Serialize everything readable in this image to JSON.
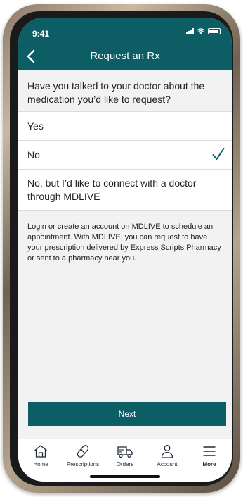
{
  "status_bar": {
    "time": "9:41"
  },
  "header": {
    "title": "Request an Rx"
  },
  "question": "Have you talked to your doctor about the medication you’d like to request?",
  "options": [
    {
      "label": "Yes",
      "selected": false
    },
    {
      "label": "No",
      "selected": true
    },
    {
      "label": "No, but I’d like to connect with a doctor through MDLIVE",
      "selected": false
    }
  ],
  "info": "Login or create an account on MDLIVE to schedule an appointment. With MDLIVE, you can request to have your prescription delivered by Express Scripts Pharmacy or sent to a pharmacy near you.",
  "next_button": "Next",
  "tabbar": {
    "items": [
      {
        "label": "Home",
        "icon": "home-icon"
      },
      {
        "label": "Prescriptions",
        "icon": "pill-icon"
      },
      {
        "label": "Orders",
        "icon": "truck-icon"
      },
      {
        "label": "Account",
        "icon": "user-icon"
      },
      {
        "label": "More",
        "icon": "menu-icon"
      }
    ]
  },
  "colors": {
    "brand": "#0d5d65",
    "check": "#0d5d65"
  }
}
